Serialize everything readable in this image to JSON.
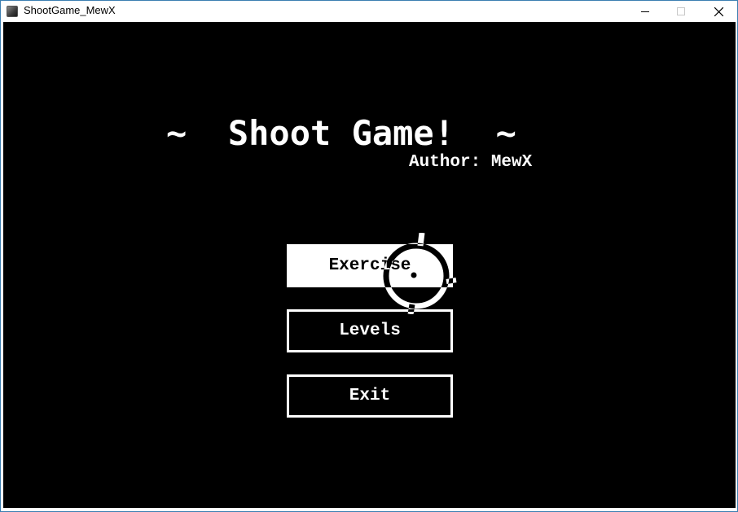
{
  "window": {
    "title": "ShootGame_MewX"
  },
  "game": {
    "title": "~  Shoot Game!  ~",
    "author": "Author: MewX",
    "menu": {
      "exercise": "Exercise",
      "levels": "Levels",
      "exit": "Exit"
    },
    "selected": "exercise"
  },
  "colors": {
    "background": "#000000",
    "foreground": "#ffffff",
    "window_border": "#3c7fb1"
  },
  "icons": {
    "app": "app-icon",
    "minimize": "minimize-icon",
    "maximize": "maximize-icon",
    "close": "close-icon",
    "cursor": "crosshair-icon"
  }
}
